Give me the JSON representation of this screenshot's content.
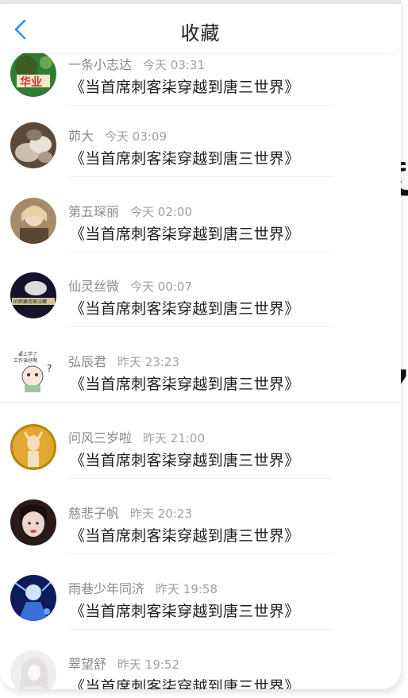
{
  "header": {
    "title": "收藏",
    "back_icon": "chevron-left-icon"
  },
  "colors": {
    "accent": "#2f8fe6",
    "text_primary": "#1f1f1f",
    "text_secondary": "#888888"
  },
  "items": [
    {
      "username": "一条小志达",
      "time": "今天 03:31",
      "book": "《当首席刺客柒穿越到唐三世界》",
      "avatar": "avatar-green"
    },
    {
      "username": "茆大",
      "time": "今天 03:09",
      "book": "《当首席刺客柒穿越到唐三世界》",
      "avatar": "avatar-stones"
    },
    {
      "username": "第五琛丽",
      "time": "今天 02:00",
      "book": "《当首席刺客柒穿越到唐三世界》",
      "avatar": "avatar-girl-brown"
    },
    {
      "username": "仙灵丝微",
      "time": "今天 00:07",
      "book": "《当首席刺客柒穿越到唐三世界》",
      "avatar": "avatar-dark-hand"
    },
    {
      "username": "弘辰君",
      "time": "昨天 23:23",
      "book": "《当首席刺客柒穿越到唐三世界》",
      "avatar": "avatar-cartoon"
    },
    {
      "username": "问风三岁啦",
      "time": "昨天 21:00",
      "book": "《当首席刺客柒穿越到唐三世界》",
      "avatar": "avatar-gold-figure"
    },
    {
      "username": "慈悲子帆",
      "time": "昨天 20:23",
      "book": "《当首席刺客柒穿越到唐三世界》",
      "avatar": "avatar-dark-girl"
    },
    {
      "username": "雨巷少年同济",
      "time": "昨天 19:58",
      "book": "《当首席刺客柒穿越到唐三世界》",
      "avatar": "avatar-blue-anime"
    },
    {
      "username": "翠望舒",
      "time": "昨天 19:52",
      "book": "《当首席刺客柒穿越到唐三世界》",
      "avatar": "avatar-white-anime"
    }
  ]
}
